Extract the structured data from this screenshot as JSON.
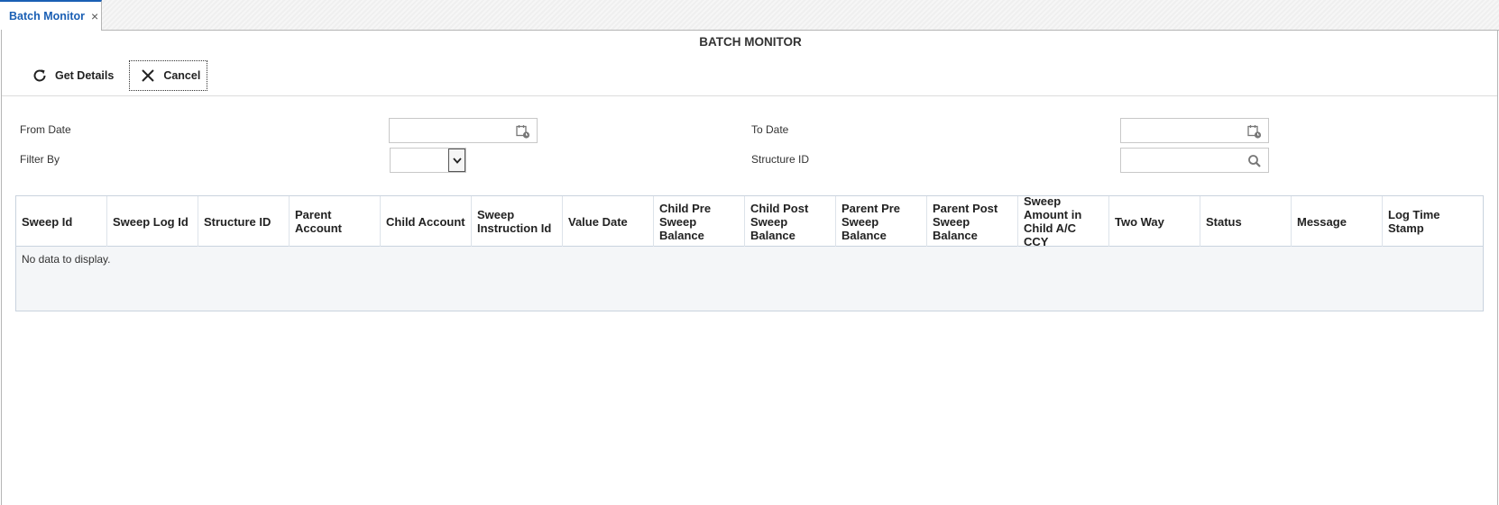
{
  "tabs": [
    {
      "label": "Batch Monitor",
      "close_glyph": "×",
      "active": true
    }
  ],
  "page": {
    "title": "BATCH MONITOR"
  },
  "toolbar": {
    "get_details_label": "Get Details",
    "get_details_icon": "refresh-icon",
    "cancel_label": "Cancel",
    "cancel_icon": "close-icon"
  },
  "form": {
    "from_date": {
      "label": "From Date",
      "value": "",
      "icon": "calendar-icon"
    },
    "to_date": {
      "label": "To Date",
      "value": "",
      "icon": "calendar-icon"
    },
    "filter_by": {
      "label": "Filter By",
      "value": ""
    },
    "structure_id": {
      "label": "Structure ID",
      "value": "",
      "icon": "search-icon"
    }
  },
  "table": {
    "columns": [
      "Sweep Id",
      "Sweep Log Id",
      "Structure ID",
      "Parent Account",
      "Child Account",
      "Sweep Instruction Id",
      "Value Date",
      "Child Pre Sweep Balance",
      "Child Post Sweep Balance",
      "Parent Pre Sweep Balance",
      "Parent Post Sweep Balance",
      "Sweep Amount in Child A/C CCY",
      "Two Way",
      "Status",
      "Message",
      "Log Time Stamp"
    ],
    "rows": [],
    "empty_message": "No data to display."
  },
  "colors": {
    "accent": "#1a5fb4",
    "border": "#c8c8c8",
    "grid_bg": "#f4f6f8"
  }
}
